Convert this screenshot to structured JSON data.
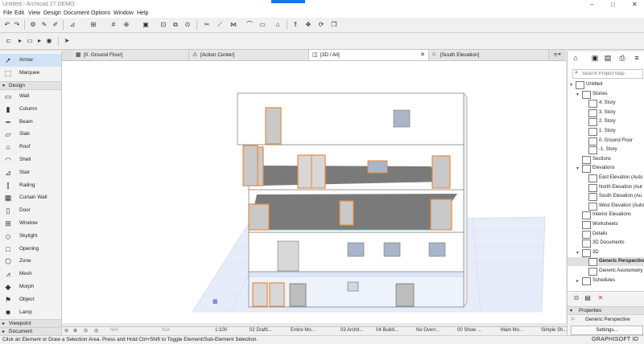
{
  "app_title": "Untitled - Archicad 27 DEMO",
  "menu": [
    "File",
    "Edit",
    "View",
    "Design",
    "Document",
    "Options",
    "Window",
    "Help"
  ],
  "window_controls": {
    "minimize": "–",
    "maximize": "□",
    "close": "✕"
  },
  "toolbox": {
    "arrow": "Arrow",
    "marquee": "Marquee",
    "design_section": "Design",
    "tools": [
      "Wall",
      "Column",
      "Beam",
      "Slab",
      "Roof",
      "Shell",
      "Stair",
      "Railing",
      "Curtain Wall",
      "Door",
      "Window",
      "Skylight",
      "Opening",
      "Zone",
      "Mesh",
      "Morph",
      "Object",
      "Lamp"
    ],
    "viewpoint_section": "Viewpoint",
    "document_section": "Document"
  },
  "tabs": [
    {
      "label": "[0. Ground Floor]",
      "icon": "floor-plan-icon"
    },
    {
      "label": "[Action Center]",
      "icon": "action-center-icon"
    },
    {
      "label": "[3D / All]",
      "icon": "3d-icon",
      "active": true
    },
    {
      "label": "[South Elevation]",
      "icon": "elevation-icon"
    }
  ],
  "navigator": {
    "search_placeholder": "Search Project Map",
    "root": "Untitled",
    "stories_label": "Stories",
    "stories": [
      "4. Story",
      "3. Story",
      "2. Story",
      "1. Story",
      "0. Ground Floor",
      "-1. Story"
    ],
    "sections": "Sections",
    "elevations_label": "Elevations",
    "elevations": [
      "East Elevation (Auto",
      "North Elevation (Aut",
      "South Elevation (Au",
      "West Elevation (Auto"
    ],
    "interior_elevations": "Interior Elevations",
    "worksheets": "Worksheets",
    "details": "Details",
    "documents_3d": "3D Documents",
    "d3_label": "3D",
    "d3_items": [
      "Generic Perspective",
      "Generic Axonometry"
    ],
    "schedules": "Schedules",
    "properties_label": "Properties",
    "properties_value": "Generic Perspective",
    "settings_button": "Settings..."
  },
  "statusbar": {
    "na1": "N/A",
    "na2": "N/A",
    "scale": "1:100",
    "layer": "02 Drafti...",
    "model": "Entire Mo...",
    "arch": "03 Archit...",
    "build": "04 Buildi...",
    "override": "No Overr...",
    "show": "00 Show ...",
    "main": "Main Mo...",
    "simple": "Simple Sh..."
  },
  "hint": "Click an Element or Draw a Selection Area. Press and Hold Ctrl+Shift to Toggle Element/Sub-Element Selection.",
  "brand": "GRAPHISOFT ID",
  "colors": {
    "selection": "#cfe3f7",
    "opening_frame": "#e88a3c",
    "floor_slab": "#7a7a7a",
    "ground_grid": "#c9d4ec",
    "brand_blue": "#1a73e8"
  }
}
